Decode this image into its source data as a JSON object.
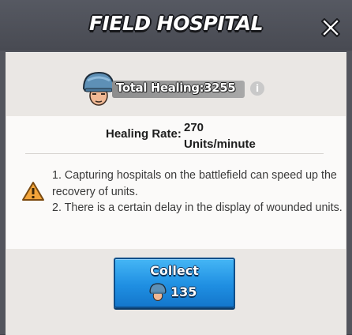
{
  "window": {
    "title": "FIELD HOSPITAL",
    "close_icon": "close-icon"
  },
  "summary": {
    "total_healing_label": "Total Healing:3255",
    "avatar_icon": "soldier-helmet-icon",
    "info_icon": "info-icon"
  },
  "details": {
    "rate_label": "Healing Rate:",
    "rate_value_line1": "270",
    "rate_value_line2": "Units/minute",
    "warning_icon": "warning-icon",
    "note_1": "1. Capturing hospitals on the battlefield can speed up the recovery of units.",
    "note_2": "2. There is a certain delay in the display of wounded units."
  },
  "collect": {
    "label": "Collect",
    "amount": "135",
    "icon": "soldier-helmet-icon"
  },
  "colors": {
    "button_blue": "#1f8fe2",
    "panel_bg": "#eae7e4",
    "header_bg": "#53555d"
  }
}
